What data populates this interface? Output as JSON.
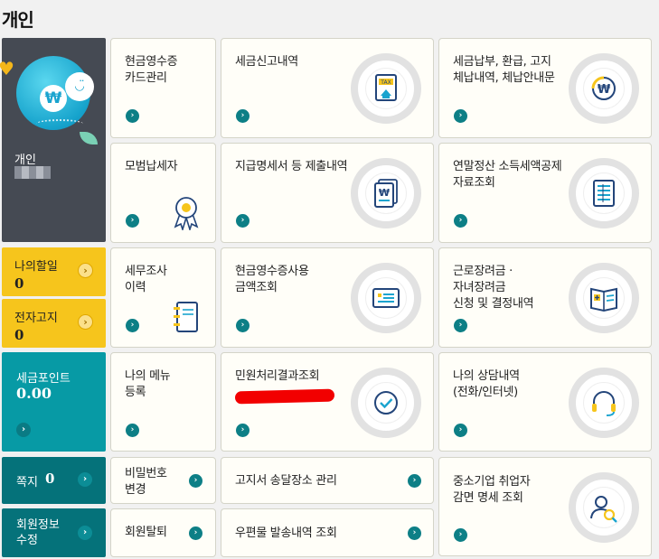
{
  "page_title": "개인",
  "profile": {
    "label": "개인",
    "coin_symbol": "₩"
  },
  "todo": {
    "label": "나의할일",
    "value": "0"
  },
  "notice": {
    "label": "전자고지",
    "value": "0"
  },
  "points": {
    "label": "세금포인트",
    "value": "0.00"
  },
  "note": {
    "label": "쪽지",
    "value": "0"
  },
  "member": {
    "label_line1": "회원정보",
    "label_line2": "수정"
  },
  "cards": {
    "cash_receipt": {
      "line1": "현금영수증",
      "line2": "카드관리"
    },
    "tax_report": {
      "line1": "세금신고내역",
      "icon_text": "TAX"
    },
    "tax_payment": {
      "line1": "세금납부, 환급, 고지",
      "line2": "체납내역, 체납안내문"
    },
    "model_taxpayer": {
      "line1": "모범납세자"
    },
    "payment_statement": {
      "line1": "지급명세서 등 제출내역"
    },
    "year_end": {
      "line1": "연말정산 소득세액공제",
      "line2": "자료조회"
    },
    "tax_audit": {
      "line1": "세무조사",
      "line2": "이력"
    },
    "cash_usage": {
      "line1": "현금영수증사용",
      "line2": "금액조회"
    },
    "earned_credit": {
      "line1": "근로장려금 ·",
      "line2": "자녀장려금",
      "line3": "신청 및 결정내역"
    },
    "my_menu": {
      "line1": "나의 메뉴",
      "line2": "등록"
    },
    "civil_result": {
      "line1": "민원처리결과조회"
    },
    "consult": {
      "line1": "나의 상담내역",
      "line2": "(전화/인터넷)"
    },
    "password": {
      "line1": "비밀번호",
      "line2": "변경"
    },
    "bill_address": {
      "line1": "고지서 송달장소 관리"
    },
    "sme_reduction": {
      "line1": "중소기업 취업자",
      "line2": "감면 명세 조회"
    },
    "withdraw": {
      "line1": "회원탈퇴"
    },
    "mail_history": {
      "line1": "우편물 발송내역 조회"
    }
  }
}
